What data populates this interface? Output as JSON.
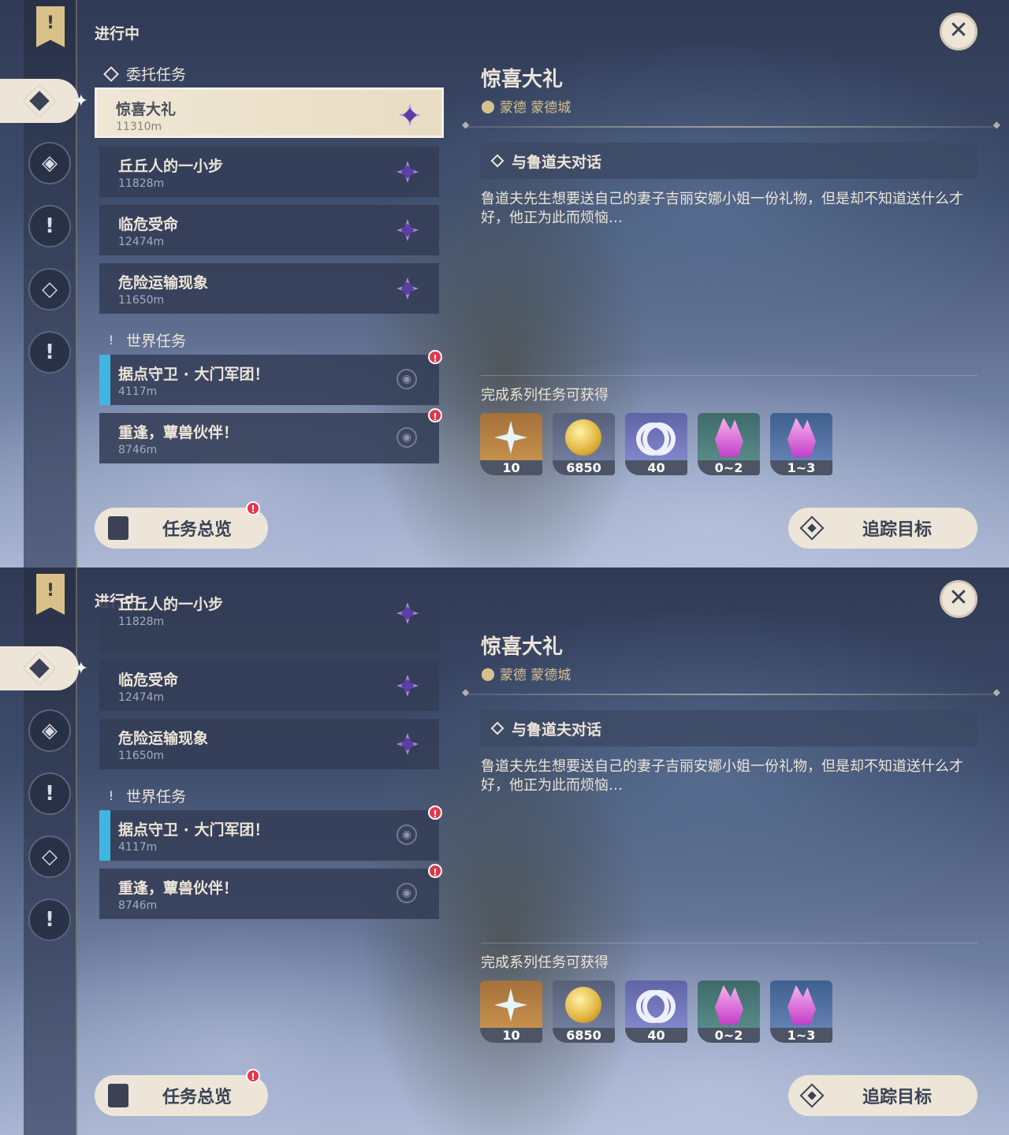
{
  "screens": [
    {
      "in_progress": "进行中",
      "section_commission": "委托任务",
      "section_world": "世界任务",
      "quests": [
        {
          "name": "惊喜大礼",
          "dist": "11310m"
        },
        {
          "name": "丘丘人的一小步",
          "dist": "11828m"
        },
        {
          "name": "临危受命",
          "dist": "12474m"
        },
        {
          "name": "危险运输现象",
          "dist": "11650m"
        }
      ],
      "world_quests": [
        {
          "name": "据点守卫 · 大门军团！",
          "dist": "4117m"
        },
        {
          "name": "重逢，蕈兽伙伴！",
          "dist": "8746m"
        }
      ]
    },
    {
      "in_progress": "进行中",
      "section_world": "世界任务",
      "quests": [
        {
          "name": "丘丘人的一小步",
          "dist": "11828m"
        },
        {
          "name": "临危受命",
          "dist": "12474m"
        },
        {
          "name": "危险运输现象",
          "dist": "11650m"
        }
      ],
      "world_quests": [
        {
          "name": "据点守卫 · 大门军团！",
          "dist": "4117m"
        },
        {
          "name": "重逢，蕈兽伙伴！",
          "dist": "8746m"
        }
      ]
    }
  ],
  "detail": {
    "title": "惊喜大礼",
    "location": "蒙德 蒙德城",
    "objective": "与鲁道夫对话",
    "description": "鲁道夫先生想要送自己的妻子吉丽安娜小姐一份礼物，但是却不知道送什么才好，他正为此而烦恼…",
    "rewards_title": "完成系列任务可获得",
    "rewards": [
      {
        "icon": "primogem-icon",
        "count": "10"
      },
      {
        "icon": "mora-icon",
        "count": "6850"
      },
      {
        "icon": "adventure-exp-icon",
        "count": "40"
      },
      {
        "icon": "crystal-icon",
        "count": "0~2"
      },
      {
        "icon": "crystal-cluster-icon",
        "count": "1~3"
      }
    ]
  },
  "buttons": {
    "overview": "任务总览",
    "track": "追踪目标",
    "close": "✕"
  },
  "badge": "!",
  "colors": {
    "accent_cream": "#ece5d8",
    "quest_purple": "#b18dec",
    "world_bar": "#3fb6e0",
    "badge_red": "#e5364a"
  }
}
